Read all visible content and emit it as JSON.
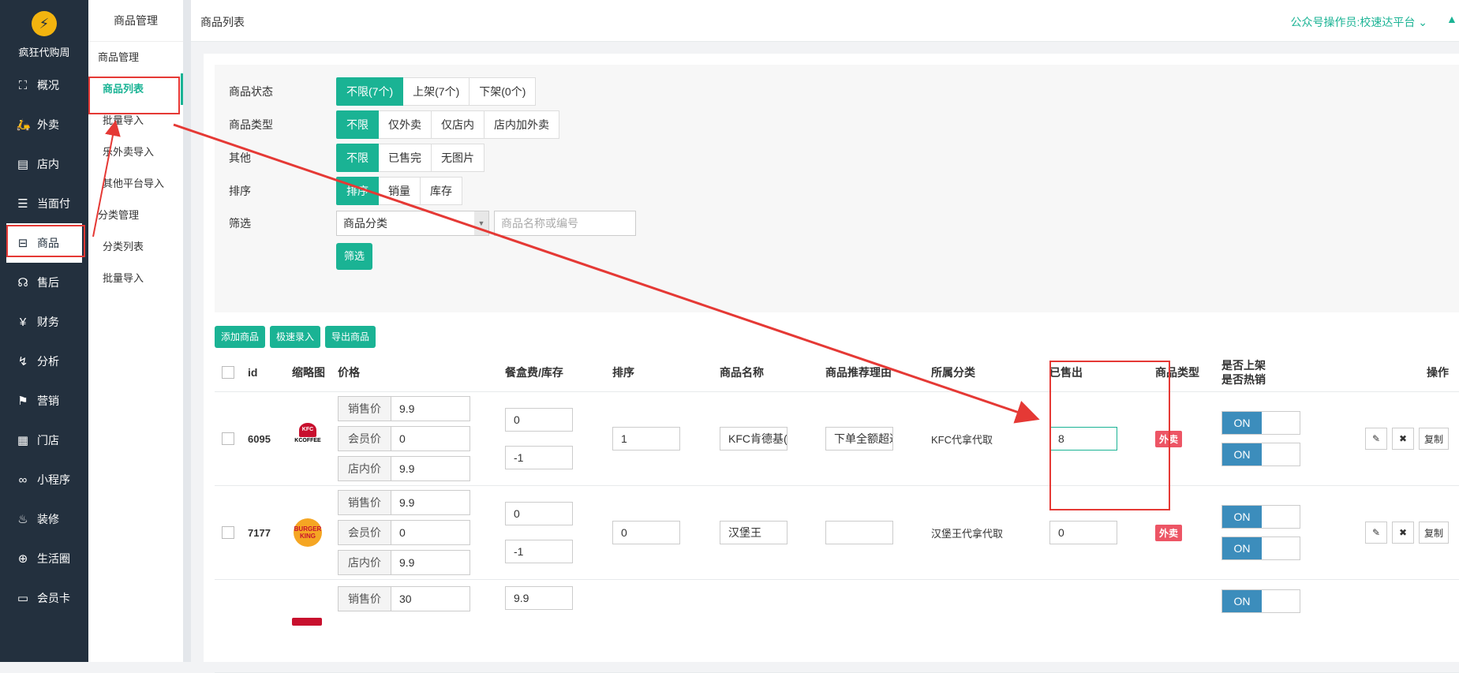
{
  "brand": {
    "name": "疯狂代购周"
  },
  "leftnav": [
    {
      "label": "概况",
      "icon": "overview-icon",
      "glyph": "⛶"
    },
    {
      "label": "外卖",
      "icon": "delivery-icon",
      "glyph": "🛵"
    },
    {
      "label": "店内",
      "icon": "store-icon",
      "glyph": "▤"
    },
    {
      "label": "当面付",
      "icon": "receipt-icon",
      "glyph": "☰"
    },
    {
      "label": "商品",
      "icon": "bag-icon",
      "glyph": "⊟"
    },
    {
      "label": "售后",
      "icon": "aftersale-icon",
      "glyph": "☊"
    },
    {
      "label": "财务",
      "icon": "finance-icon",
      "glyph": "¥"
    },
    {
      "label": "分析",
      "icon": "analytics-icon",
      "glyph": "↯"
    },
    {
      "label": "营销",
      "icon": "marketing-icon",
      "glyph": "⚑"
    },
    {
      "label": "门店",
      "icon": "shop-icon",
      "glyph": "▦"
    },
    {
      "label": "小程序",
      "icon": "miniprogram-icon",
      "glyph": "∞"
    },
    {
      "label": "装修",
      "icon": "decorate-icon",
      "glyph": "♨"
    },
    {
      "label": "生活圈",
      "icon": "globe-icon",
      "glyph": "⊕"
    },
    {
      "label": "会员卡",
      "icon": "card-icon",
      "glyph": "▭"
    }
  ],
  "subnav": {
    "head": "商品管理",
    "items": [
      "商品管理",
      "商品列表",
      "批量导入",
      "乐外卖导入",
      "其他平台导入",
      "分类管理",
      "分类列表",
      "批量导入"
    ]
  },
  "topbar": {
    "title": "商品列表",
    "operator": "公众号操作员:校速达平台",
    "chevron": "⌄"
  },
  "filters": {
    "status": {
      "label": "商品状态",
      "options": [
        "不限(7个)",
        "上架(7个)",
        "下架(0个)"
      ]
    },
    "type": {
      "label": "商品类型",
      "options": [
        "不限",
        "仅外卖",
        "仅店内",
        "店内加外卖"
      ]
    },
    "other": {
      "label": "其他",
      "options": [
        "不限",
        "已售完",
        "无图片"
      ]
    },
    "sort": {
      "label": "排序",
      "options": [
        "排序",
        "销量",
        "库存"
      ]
    },
    "screen": {
      "label": "筛选",
      "category": "商品分类",
      "keyword_placeholder": "商品名称或编号",
      "button": "筛选"
    }
  },
  "actions": [
    "添加商品",
    "极速录入",
    "导出商品"
  ],
  "table": {
    "headers": [
      "id",
      "缩略图",
      "价格",
      "餐盒费/库存",
      "排序",
      "商品名称",
      "商品推荐理由",
      "所属分类",
      "已售出",
      "商品类型",
      "是否上架",
      "是否热销",
      "操作"
    ],
    "price_labels": [
      "销售价",
      "会员价",
      "店内价"
    ],
    "rows": [
      {
        "id": "6095",
        "thumb": "kfc",
        "prices": [
          "9.9",
          "0",
          "9.9"
        ],
        "box_fee": "0",
        "stock": "-1",
        "sort": "1",
        "name": "KFC肯德基(",
        "reason": "下单全额超过",
        "category": "KFC代拿代取",
        "sold": "8",
        "type": "外卖",
        "on_sale": "ON",
        "hot": "ON"
      },
      {
        "id": "7177",
        "thumb": "bk",
        "prices": [
          "9.9",
          "0",
          "9.9"
        ],
        "box_fee": "0",
        "stock": "-1",
        "sort": "0",
        "name": "汉堡王",
        "reason": "",
        "category": "汉堡王代拿代取",
        "sold": "0",
        "type": "外卖",
        "on_sale": "ON",
        "hot": "ON"
      },
      {
        "id": "",
        "thumb": "red",
        "prices": [
          "30"
        ],
        "box_fee": "9.9",
        "on_sale": "ON"
      }
    ],
    "op_buttons": {
      "edit_glyph": "✎",
      "delete_glyph": "✖",
      "copy": "复制"
    }
  },
  "kfc_logo": {
    "top": "KFC",
    "bottom": "KCOFFEE"
  },
  "bk_logo": {
    "top": "BURGER",
    "bottom": "KING"
  },
  "colors": {
    "accent": "#1ab394",
    "nav_bg": "#23303e",
    "annotation": "#e53935",
    "toggle_on": "#3c8dbc",
    "badge": "#ed5565"
  }
}
